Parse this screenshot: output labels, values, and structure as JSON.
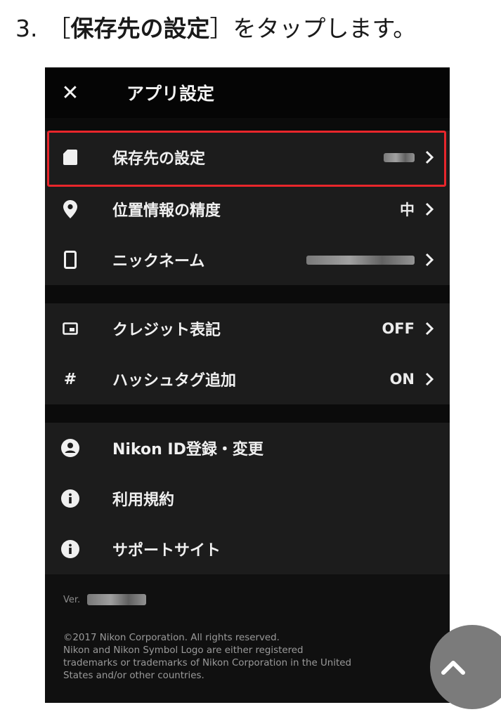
{
  "instruction": {
    "number": "3.",
    "open_bracket": "［",
    "bold_text": "保存先の設定",
    "close_bracket": "］",
    "rest": "をタップします。"
  },
  "appbar": {
    "close_symbol": "✕",
    "title": "アプリ設定"
  },
  "settings": {
    "storage": {
      "icon": "sd-card-icon",
      "label": "保存先の設定",
      "value": ""
    },
    "location": {
      "icon": "location-pin-icon",
      "label": "位置情報の精度",
      "value": "中"
    },
    "nickname": {
      "icon": "smartphone-icon",
      "label": "ニックネーム",
      "value": ""
    },
    "credit": {
      "icon": "image-frame-icon",
      "label": "クレジット表記",
      "value": "OFF"
    },
    "hashtag": {
      "icon": "hash-icon",
      "label": "ハッシュタグ追加",
      "value": "ON",
      "symbol": "#"
    },
    "nikon_id": {
      "icon": "account-circle-icon",
      "label": "Nikon ID登録・変更"
    },
    "terms": {
      "icon": "info-icon",
      "label": "利用規約"
    },
    "support": {
      "icon": "info-icon",
      "label": "サポートサイト"
    }
  },
  "footer": {
    "version_label": "Ver.",
    "copyright_lines": [
      "©2017 Nikon Corporation. All rights reserved.",
      "Nikon and Nikon Symbol Logo are either registered",
      "trademarks or trademarks of Nikon Corporation in the United",
      "States and/or other countries."
    ]
  },
  "colors": {
    "highlight": "#e8262b",
    "scroll_button": "#7b7b7b"
  }
}
